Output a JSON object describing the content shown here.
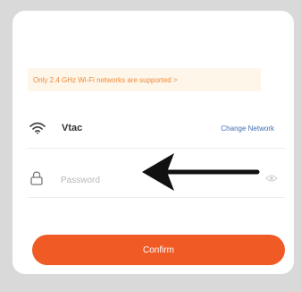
{
  "notice": {
    "text": "Only 2.4 GHz Wi-Fi networks are supported >"
  },
  "network": {
    "icon": "wifi-icon",
    "name": "Vtac",
    "change_label": "Change Network"
  },
  "password": {
    "icon": "lock-icon",
    "placeholder": "Password",
    "value": "",
    "visibility_icon": "eye-icon"
  },
  "confirm": {
    "label": "Confirm"
  },
  "colors": {
    "accent": "#ef5a25",
    "notice_text": "#f08a3c",
    "notice_bg": "#fdf6e9",
    "link": "#3f6fb5"
  }
}
